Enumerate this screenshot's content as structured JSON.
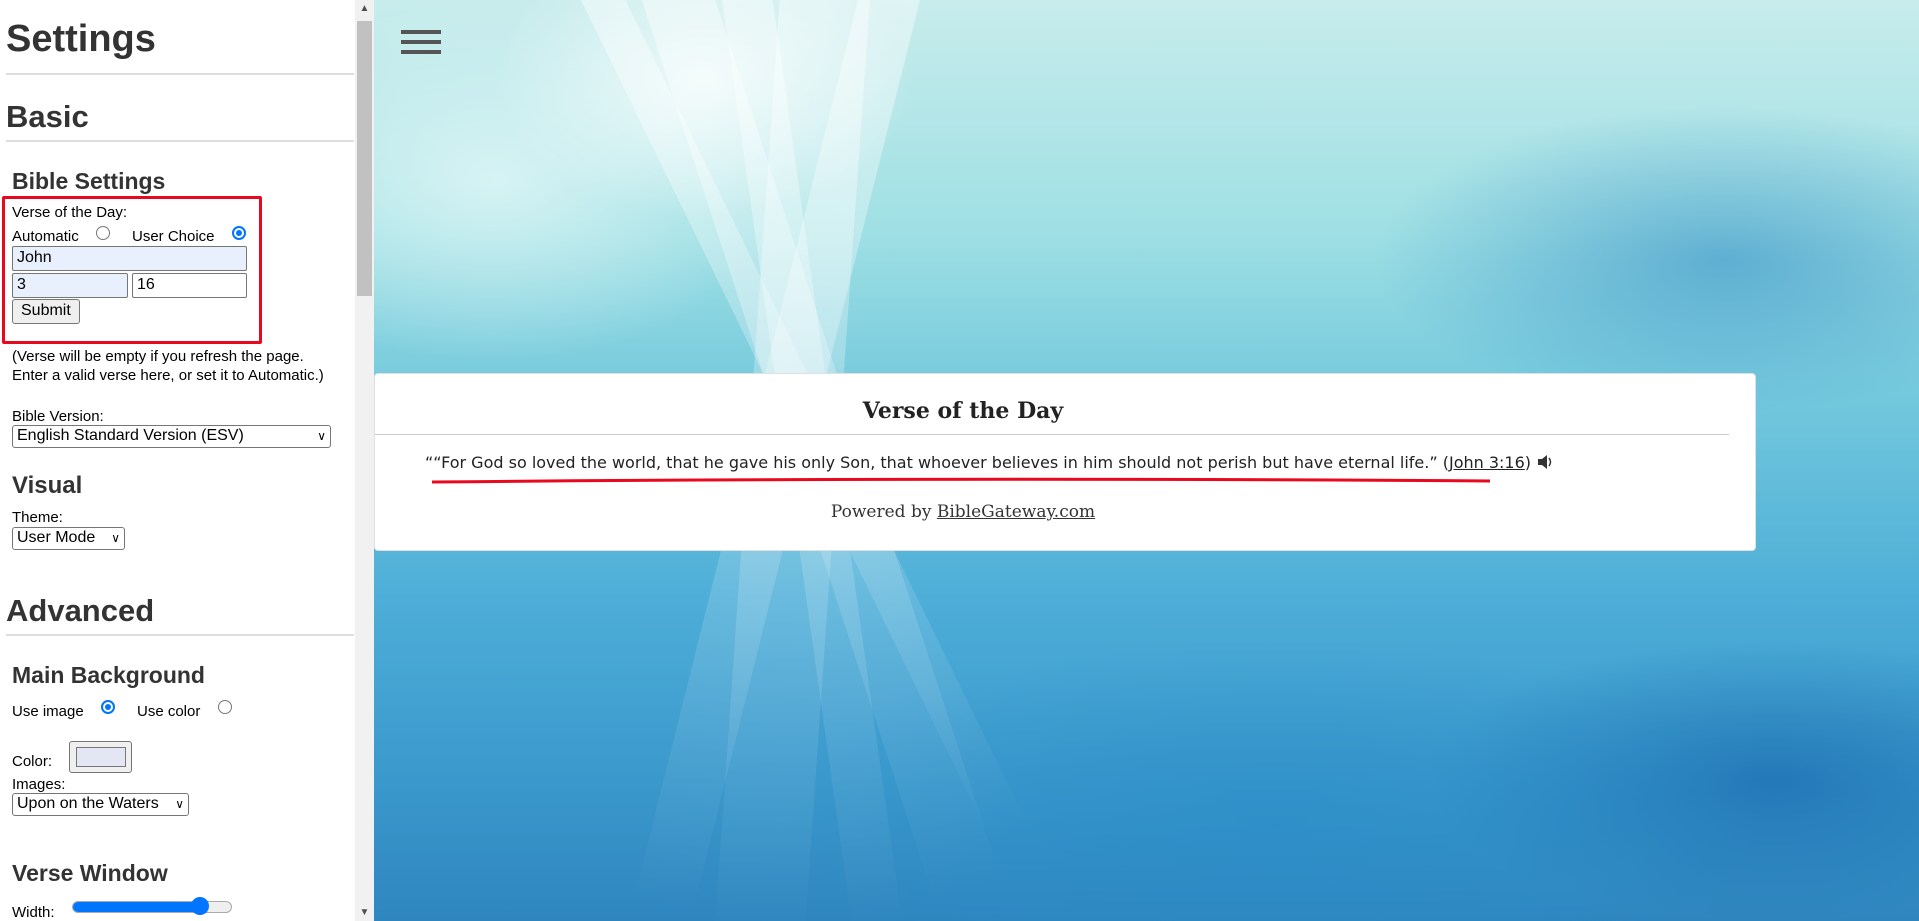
{
  "sidebar": {
    "title": "Settings",
    "basic": {
      "heading": "Basic",
      "bible_settings": {
        "heading": "Bible Settings",
        "verse_of_day_label": "Verse of the Day:",
        "automatic_label": "Automatic",
        "user_choice_label": "User Choice",
        "selected_mode": "User Choice",
        "book_value": "John",
        "chapter_value": "3",
        "verse_value": "16",
        "submit_label": "Submit",
        "note_line1": "(Verse will be empty if you refresh the page.",
        "note_line2": "Enter a valid verse here, or set it to Automatic.)",
        "version_label": "Bible Version:",
        "version_value": "English Standard Version (ESV)"
      },
      "visual": {
        "heading": "Visual",
        "theme_label": "Theme:",
        "theme_value": "User Mode"
      }
    },
    "advanced": {
      "heading": "Advanced",
      "main_background": {
        "heading": "Main Background",
        "use_image_label": "Use image",
        "use_color_label": "Use color",
        "selected": "Use image",
        "color_label": "Color:",
        "color_value": "#e4e6f4",
        "images_label": "Images:",
        "images_value": "Upon on the Waters"
      },
      "verse_window": {
        "heading": "Verse Window",
        "width_label": "Width:",
        "width_level": 0.8
      }
    }
  },
  "main": {
    "menu_icon": "hamburger-menu-icon",
    "verse_card": {
      "title": "Verse of the Day",
      "quote_open": "“",
      "verse_text": "“For God so loved the world, that he gave his only Son, that whoever believes in him should not perish but have eternal life.”",
      "ref_open": "(",
      "reference": "John 3:16",
      "ref_close": ")",
      "speaker_icon": "speaker-icon",
      "powered_prefix": "Powered by ",
      "powered_link": "BibleGateway.com"
    }
  },
  "colors": {
    "highlight": "#e8091e",
    "radio_accent": "#0075ff"
  }
}
